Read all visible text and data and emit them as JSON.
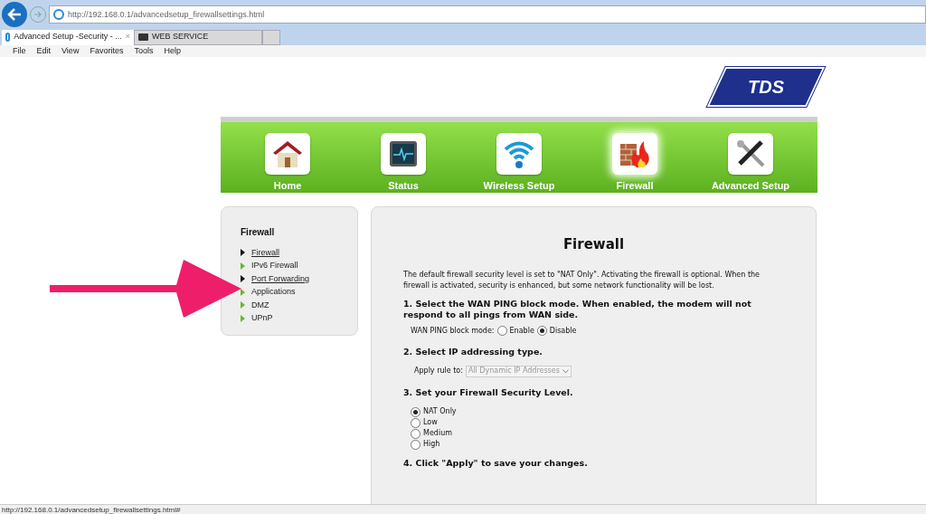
{
  "browser": {
    "address": "http://192.168.0.1/advancedsetup_firewallsettings.html",
    "tabs": [
      {
        "label": "Advanced Setup -Security - ...",
        "close": "×",
        "selected": true
      },
      {
        "label": "WEB SERVICE",
        "selected": false
      }
    ],
    "menu": [
      "File",
      "Edit",
      "View",
      "Favorites",
      "Tools",
      "Help"
    ],
    "status_bar": "http://192.168.0.1/advancedsetup_firewallsettings.html#"
  },
  "logo": {
    "text": "TDS"
  },
  "nav": [
    {
      "label": "Home",
      "kind": "home",
      "selected": false
    },
    {
      "label": "Status",
      "kind": "status",
      "selected": false
    },
    {
      "label": "Wireless Setup",
      "kind": "wireless",
      "selected": false
    },
    {
      "label": "Firewall",
      "kind": "firewall",
      "selected": true
    },
    {
      "label": "Advanced Setup",
      "kind": "tools",
      "selected": false
    }
  ],
  "sidebar": {
    "title": "Firewall",
    "items": [
      {
        "label": "Firewall",
        "highlighted": true
      },
      {
        "label": "IPv6 Firewall",
        "highlighted": false
      },
      {
        "label": "Port Forwarding",
        "highlighted": true
      },
      {
        "label": "Applications",
        "highlighted": false
      },
      {
        "label": "DMZ",
        "highlighted": false
      },
      {
        "label": "UPnP",
        "highlighted": false
      }
    ]
  },
  "main": {
    "title": "Firewall",
    "intro": "The default firewall security level is set to \"NAT Only\". Activating the firewall is optional. When the firewall is activated, security is enhanced, but some network functionality will be lost.",
    "step1": "1. Select the WAN PING block mode. When enabled, the modem will not respond to all pings from WAN side.",
    "ping_label": "WAN PING block mode:",
    "ping_options": [
      {
        "label": "Enable",
        "selected": false
      },
      {
        "label": "Disable",
        "selected": true
      }
    ],
    "step2": "2. Select IP addressing type.",
    "apply_label": "Apply rule to:",
    "apply_value": "All Dynamic IP Addresses",
    "step3": "3. Set your Firewall Security Level.",
    "levels": [
      {
        "label": "NAT Only",
        "selected": true
      },
      {
        "label": "Low",
        "selected": false
      },
      {
        "label": "Medium",
        "selected": false
      },
      {
        "label": "High",
        "selected": false
      }
    ],
    "step4": "4. Click \"Apply\" to save your changes."
  }
}
